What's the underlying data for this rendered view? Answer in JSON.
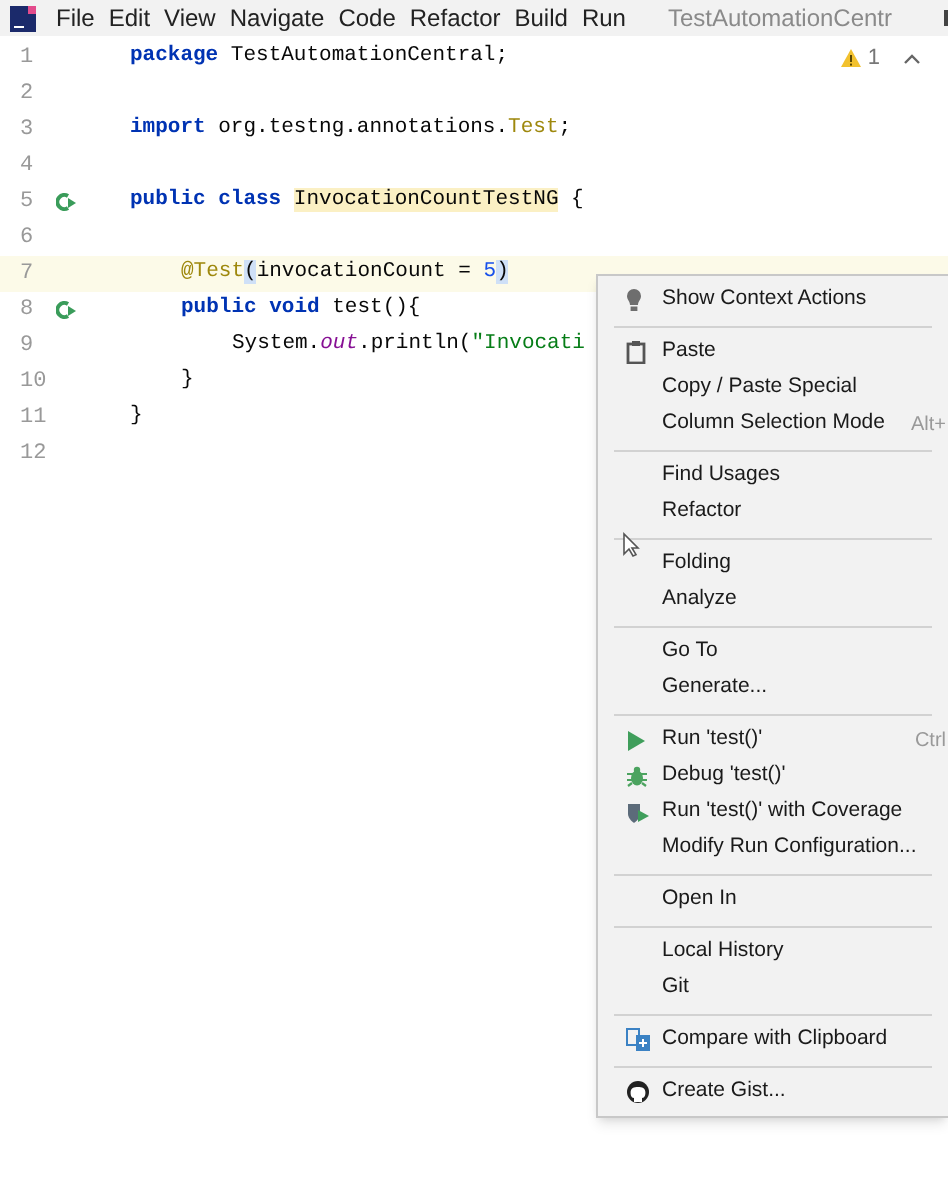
{
  "title_bar": {
    "menus": [
      "File",
      "Edit",
      "View",
      "Navigate",
      "Code",
      "Refactor",
      "Build",
      "Run"
    ],
    "title": "TestAutomationCentr"
  },
  "inspections": {
    "warnings": "1"
  },
  "editor": {
    "lines": [
      {
        "number": "1",
        "current": false,
        "gutter": false,
        "tokens": [
          {
            "text": "package",
            "kind": "keyword"
          },
          {
            "text": " TestAutomationCentral;",
            "kind": "plain"
          }
        ]
      },
      {
        "number": "2",
        "current": false,
        "gutter": false
      },
      {
        "number": "3",
        "current": false,
        "gutter": false,
        "tokens": [
          {
            "text": "import",
            "kind": "keyword"
          },
          {
            "text": " org.testng.annotations.",
            "kind": "plain"
          },
          {
            "text": "Test",
            "kind": "annotation"
          },
          {
            "text": ";",
            "kind": "plain"
          }
        ]
      },
      {
        "number": "4",
        "current": false,
        "gutter": false
      },
      {
        "number": "5",
        "current": false,
        "gutter": true,
        "tokens": [
          {
            "text": "public class ",
            "kind": "keyword"
          },
          {
            "text": "InvocationCountTestNG",
            "kind": "highlight"
          },
          {
            "text": " {",
            "kind": "plain"
          }
        ],
        "children": [
          {
            "number": "6",
            "current": false,
            "gutter": false
          },
          {
            "number": "7",
            "current": true,
            "gutter": false,
            "tokens": [
              {
                "text": "@Test",
                "kind": "annotation"
              },
              {
                "text": "(",
                "kind": "brace"
              },
              {
                "text": "invocationCount = ",
                "kind": "plain"
              },
              {
                "text": "5",
                "kind": "number"
              },
              {
                "text": ")",
                "kind": "brace"
              }
            ]
          },
          {
            "number": "8",
            "current": false,
            "gutter": true,
            "tokens": [
              {
                "text": "public void",
                "kind": "keyword"
              },
              {
                "text": " test(){",
                "kind": "plain"
              }
            ],
            "children": [
              {
                "number": "9",
                "current": false,
                "gutter": false,
                "tokens": [
                  {
                    "text": "System.",
                    "kind": "plain"
                  },
                  {
                    "text": "out",
                    "kind": "italic"
                  },
                  {
                    "text": ".println(",
                    "kind": "plain"
                  },
                  {
                    "text": "\"Invocati",
                    "kind": "string"
                  }
                ]
              }
            ]
          },
          {
            "number": "10",
            "current": false,
            "gutter": false,
            "tokens": [
              {
                "text": "}",
                "kind": "plain"
              }
            ]
          }
        ]
      },
      {
        "number": "11",
        "current": false,
        "gutter": false,
        "tokens": [
          {
            "text": "}",
            "kind": "plain"
          }
        ]
      },
      {
        "number": "12",
        "current": false,
        "gutter": false
      }
    ]
  },
  "context_menu": {
    "sections": [
      [
        {
          "label": "Show Context Actions",
          "kind": "bulb"
        }
      ],
      [
        {
          "label": "Paste",
          "kind": "paste"
        },
        {
          "label": "Copy / Paste Special",
          "kind": "plain"
        },
        {
          "label": "Column Selection Mode",
          "kind": "plain",
          "shortcut": "Alt+"
        }
      ],
      [
        {
          "label": "Find Usages",
          "kind": "plain"
        },
        {
          "label": "Refactor",
          "kind": "plain"
        }
      ],
      [
        {
          "label": "Folding",
          "kind": "plain"
        },
        {
          "label": "Analyze",
          "kind": "plain"
        }
      ],
      [
        {
          "label": "Go To",
          "kind": "plain"
        },
        {
          "label": "Generate...",
          "kind": "plain"
        }
      ],
      [
        {
          "label": "Run 'test()'",
          "kind": "run",
          "shortcut": "Ctrl"
        },
        {
          "label": "Debug 'test()'",
          "kind": "debug"
        },
        {
          "label": "Run 'test()' with Coverage",
          "kind": "coverage"
        },
        {
          "label": "Modify Run Configuration...",
          "kind": "plain"
        }
      ],
      [
        {
          "label": "Open In",
          "kind": "plain"
        }
      ],
      [
        {
          "label": "Local History",
          "kind": "plain"
        },
        {
          "label": "Git",
          "kind": "plain"
        }
      ],
      [
        {
          "label": "Compare with Clipboard",
          "kind": "compare"
        }
      ],
      [
        {
          "label": "Create Gist...",
          "kind": "github"
        }
      ]
    ]
  }
}
